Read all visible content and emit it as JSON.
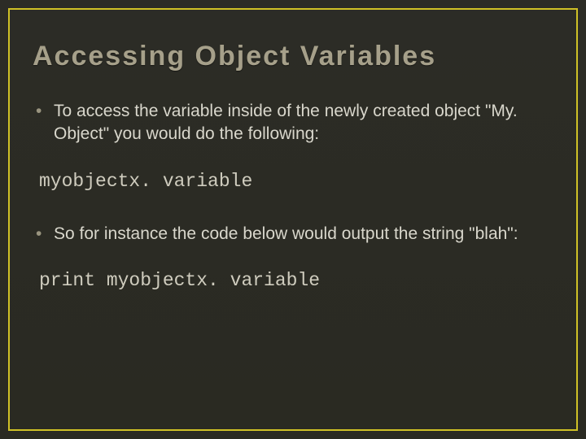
{
  "slide": {
    "title": "Accessing Object Variables",
    "items": [
      {
        "text": "To access the variable inside of the newly created object \"My. Object\" you would do the following:"
      },
      {
        "code": "myobjectx. variable"
      },
      {
        "text": "So for instance the code below would output the string \"blah\":"
      },
      {
        "code": "print myobjectx. variable"
      }
    ]
  },
  "colors": {
    "background": "#2b2b23",
    "border": "#cfc126",
    "title": "#a6a08a",
    "body": "#d9d7cc"
  }
}
